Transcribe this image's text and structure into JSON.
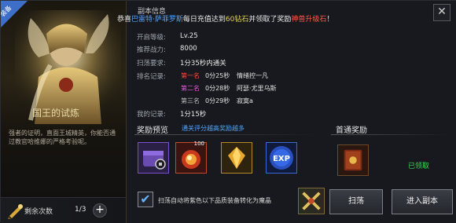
{
  "equip_tag": "装备",
  "trial_title": "国王的试炼",
  "description": "强者的证明，直面王城精英，你能否通过教官哈维娜的严格考验呢。",
  "remaining": {
    "label": "剩余次数",
    "count": "1/3",
    "plus": "+"
  },
  "close": "✕",
  "marquee": {
    "prefix": "恭喜",
    "player": "巴雷特·萨菲罗斯",
    "middle": "每日充值达到",
    "amount": "60钻石",
    "middle2": "并领取了奖励",
    "reward": "神兽升级石",
    "suffix": "！"
  },
  "section_title": "副本信息",
  "info": {
    "level_label": "开启等级:",
    "level_value": "Lv.25",
    "power_label": "推荐战力:",
    "power_value": "8000",
    "sweep_label": "扫荡要求:",
    "sweep_value": "1分35秒内通关",
    "rank_label": "排名记录:",
    "my_label": "我的记录:",
    "my_value": "1分15秒"
  },
  "ranks": [
    {
      "pos": "第一名",
      "time": "0分25秒",
      "name": "情绪控一凡",
      "color": "#ff4a3d"
    },
    {
      "pos": "第二名",
      "time": "0分28秒",
      "name": "阿瑟·尤里乌斯",
      "color": "#e05ad6"
    },
    {
      "pos": "第三名",
      "time": "0分29秒",
      "name": "寂寞a",
      "color": "#bdbdbd"
    }
  ],
  "reward_preview": {
    "title": "奖励预览",
    "sub": "通关评分越高奖励越多"
  },
  "items": [
    {
      "icon": "purple-lock-chest-icon"
    },
    {
      "icon": "red-orb-icon",
      "count": "100"
    },
    {
      "icon": "gold-crystal-icon"
    },
    {
      "icon": "exp-icon",
      "text": "EXP"
    }
  ],
  "first_reward": {
    "title": "首通奖励",
    "icon": "red-book-icon",
    "status": "已领取"
  },
  "auto_convert_label": "扫荡自动将紫色以下品质装备转化为魔晶",
  "sweep_button": "扫荡",
  "enter_button": "进入副本"
}
